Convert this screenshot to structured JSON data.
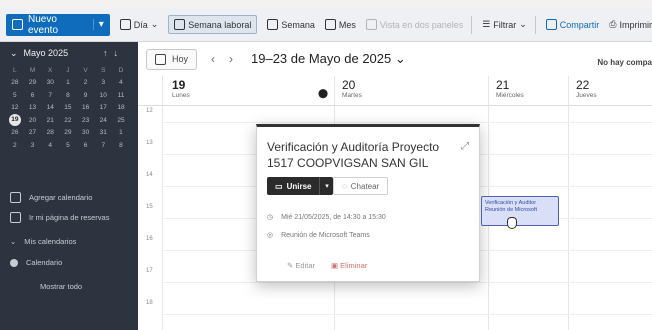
{
  "toolbar": {
    "new_event": "Nuevo evento",
    "day": "Día",
    "work_week": "Semana laboral",
    "week": "Semana",
    "month": "Mes",
    "split_view": "Vista en dos paneles",
    "filter": "Filtrar",
    "share": "Compartir",
    "print": "Imprimir"
  },
  "mini_calendar": {
    "month": "Mayo 2025",
    "weekdays": [
      "L",
      "M",
      "X",
      "J",
      "V",
      "S",
      "D"
    ],
    "weeks": [
      [
        "28",
        "29",
        "30",
        "1",
        "2",
        "3",
        "4"
      ],
      [
        "5",
        "6",
        "7",
        "8",
        "9",
        "10",
        "11"
      ],
      [
        "12",
        "13",
        "14",
        "15",
        "16",
        "17",
        "18"
      ],
      [
        "19",
        "20",
        "21",
        "22",
        "23",
        "24",
        "25"
      ],
      [
        "26",
        "27",
        "28",
        "29",
        "30",
        "31",
        "1"
      ],
      [
        "2",
        "3",
        "4",
        "5",
        "6",
        "7",
        "8"
      ]
    ],
    "today": "19"
  },
  "sidebar": {
    "add_calendar": "Agregar calendario",
    "booking_page": "Ir mi página de reservas",
    "my_calendars": "Mis calendarios",
    "calendar": "Calendario",
    "show_all": "Mostrar todo"
  },
  "header": {
    "today": "Hoy",
    "range": "19–23 de Mayo de 2025",
    "no_companies": "No hay compa"
  },
  "days": [
    {
      "num": "19",
      "name": "Lunes"
    },
    {
      "num": "20",
      "name": "Martes"
    },
    {
      "num": "21",
      "name": "Miércoles"
    },
    {
      "num": "22",
      "name": "Jueves"
    }
  ],
  "hours": [
    "12",
    "13",
    "14",
    "15",
    "16",
    "17",
    "18"
  ],
  "popup": {
    "title": "Verificación y Auditoría Proyecto 1517 COOPVIGSAN SAN GIL",
    "join": "Unirse",
    "chat": "Chatear",
    "when": "Mié 21/05/2025, de 14:30 a 15:30",
    "where": "Reunión de Microsoft Teams",
    "edit": "Editar",
    "delete": "Eliminar"
  },
  "event": {
    "title": "Verificación y Auditor",
    "subtitle": "Reunión de Microsoft"
  }
}
